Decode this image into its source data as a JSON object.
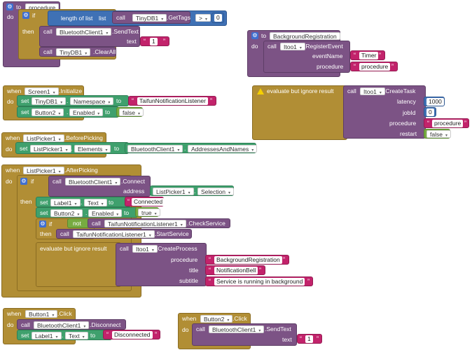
{
  "labels": {
    "to": "to",
    "do": "do",
    "if": "if",
    "then": "then",
    "when": "when",
    "set": "set",
    "call": "call",
    "not": "not",
    "eval": "evaluate but ignore result",
    "dot": "."
  },
  "proc1": {
    "name": "procedure",
    "length": "length of list",
    "list": "list",
    "db": "TinyDB1",
    "gettags": ".GetTags",
    "op": ">",
    "zero": "0",
    "bt": "BluetoothClient1",
    "sendtext": ".SendText",
    "text_lbl": "text",
    "one": "1",
    "clearall": ".ClearAll"
  },
  "bgreg": {
    "name": "BackgroundRegistration",
    "comp": "Itoo1",
    "method": ".RegisterEvent",
    "event_lbl": "eventName",
    "event_val": "Timer",
    "proc_lbl": "procedure",
    "proc_val": "procedure"
  },
  "screen": {
    "comp": "Screen1",
    "event": ".Initialize",
    "db": "TinyDB1",
    "prop_ns": "Namespace",
    "ns_val": "TaifunNotificationListener",
    "btn": "Button2",
    "prop_en": "Enabled",
    "en_val": "false"
  },
  "task": {
    "comp": "Itoo1",
    "method": ".CreateTask",
    "latency_lbl": "latency",
    "latency_val": "1000",
    "jobid_lbl": "jobId",
    "jobid_val": "0",
    "proc_lbl": "procedure",
    "proc_val": "procedure",
    "restart_lbl": "restart",
    "restart_val": "false"
  },
  "before": {
    "comp": "ListPicker1",
    "event": ".BeforePicking",
    "prop": "Elements",
    "bt": "BluetoothClient1",
    "bt_prop": "AddressesAndNames"
  },
  "after": {
    "comp": "ListPicker1",
    "event": ".AfterPicking",
    "bt": "BluetoothClient1",
    "connect": ".Connect",
    "addr_lbl": "address",
    "lp_prop": "Selection",
    "label": "Label1",
    "text_prop": "Text",
    "connected": "Connected",
    "btn": "Button2",
    "en_prop": "Enabled",
    "true_val": "true",
    "tnl": "TaifunNotificationListener1",
    "check": ".CheckService",
    "start": ".StartService",
    "itoo": "Itoo1",
    "createproc": ".CreateProcess",
    "proc_lbl": "procedure",
    "proc_val": "BackgroundRegistration",
    "title_lbl": "title",
    "title_val": "NotificationBell",
    "sub_lbl": "subtitle",
    "sub_val": "Service is running in background"
  },
  "btn1": {
    "comp": "Button1",
    "event": ".Click",
    "bt": "BluetoothClient1",
    "disconnect": ".Disconnect",
    "label": "Label1",
    "text_prop": "Text",
    "disc_val": "Disconnected"
  },
  "btn2": {
    "comp": "Button2",
    "event": ".Click",
    "bt": "BluetoothClient1",
    "sendtext": ".SendText",
    "text_lbl": "text",
    "one": "1"
  },
  "colors": {
    "control": "#b18e35",
    "procedure": "#7c5385",
    "component": "#7c5385",
    "text": "#c2236b",
    "logic": "#77ab41",
    "math": "#3f71b5",
    "getter": "#3fa06d"
  }
}
